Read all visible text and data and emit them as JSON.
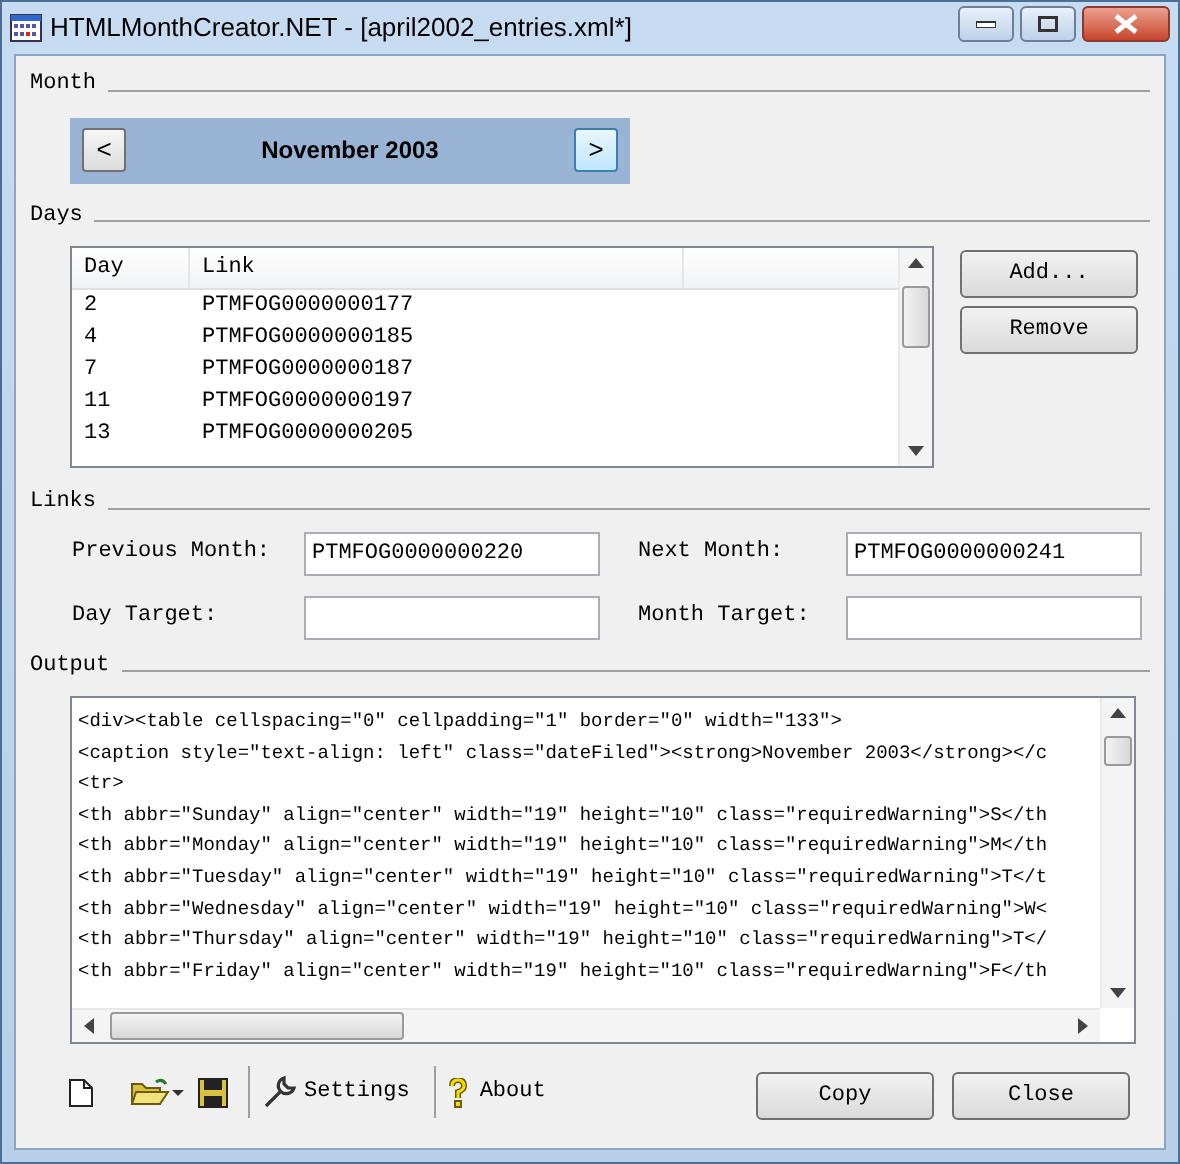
{
  "window": {
    "title": "HTMLMonthCreator.NET - [april2002_entries.xml*]"
  },
  "month": {
    "label": "Month",
    "prev": "<",
    "value": "November 2003",
    "next": ">"
  },
  "days": {
    "label": "Days",
    "columns": [
      "Day",
      "Link"
    ],
    "rows": [
      {
        "day": "2",
        "link": "PTMFOG0000000177"
      },
      {
        "day": "4",
        "link": "PTMFOG0000000185"
      },
      {
        "day": "7",
        "link": "PTMFOG0000000187"
      },
      {
        "day": "11",
        "link": "PTMFOG0000000197"
      },
      {
        "day": "13",
        "link": "PTMFOG0000000205"
      }
    ],
    "buttons": [
      "Add...",
      "Remove"
    ]
  },
  "links": {
    "label": "Links",
    "fields": [
      {
        "label": "Previous Month:",
        "value": "PTMFOG0000000220"
      },
      {
        "label": "Next Month:",
        "value": "PTMFOG0000000241"
      },
      {
        "label": "Day Target:"
      },
      {
        "label": "Month Target:"
      }
    ]
  },
  "output": {
    "label": "Output",
    "lines": [
      "<div><table cellspacing=\"0\" cellpadding=\"1\" border=\"0\" width=\"133\">",
      "<caption style=\"text-align: left\" class=\"dateFiled\"><strong>November 2003</strong></c",
      "<tr>",
      "<th abbr=\"Sunday\" align=\"center\" width=\"19\" height=\"10\" class=\"requiredWarning\">S</th",
      "<th abbr=\"Monday\" align=\"center\" width=\"19\" height=\"10\" class=\"requiredWarning\">M</th",
      "<th abbr=\"Tuesday\" align=\"center\" width=\"19\" height=\"10\" class=\"requiredWarning\">T</t",
      "<th abbr=\"Wednesday\" align=\"center\" width=\"19\" height=\"10\" class=\"requiredWarning\">W<",
      "<th abbr=\"Thursday\" align=\"center\" width=\"19\" height=\"10\" class=\"requiredWarning\">T</",
      "<th abbr=\"Friday\" align=\"center\" width=\"19\" height=\"10\" class=\"requiredWarning\">F</th"
    ]
  },
  "toolbar": {
    "labels": [
      "Settings",
      "About"
    ]
  },
  "buttons": [
    "Copy",
    "Close"
  ]
}
